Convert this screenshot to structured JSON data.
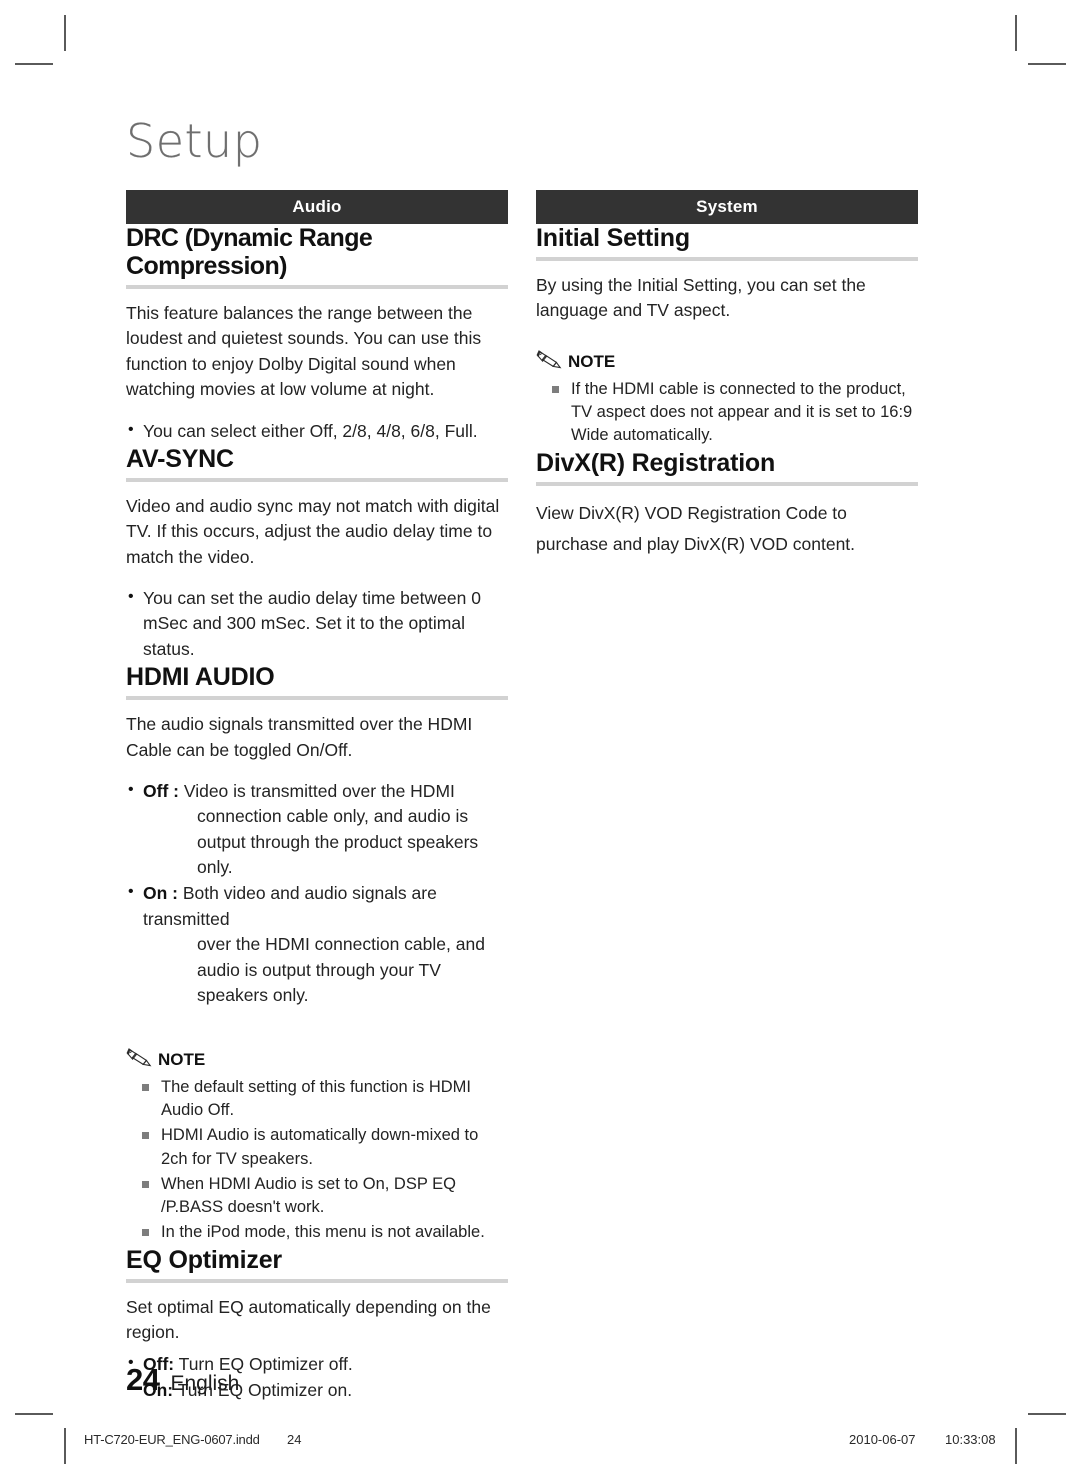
{
  "page": {
    "title": "Setup",
    "page_number": "24",
    "language": "English"
  },
  "left_column": {
    "banner": "Audio",
    "sections": [
      {
        "heading": "DRC (Dynamic Range Compression)",
        "paragraph": "This feature balances the range between the loudest and quietest sounds. You can use this function to enjoy Dolby Digital sound when watching movies at low volume at night.",
        "bullets": [
          {
            "text": "You can select either Off, 2/8, 4/8, 6/8, Full."
          }
        ]
      },
      {
        "heading": "AV-SYNC",
        "paragraph": "Video and audio sync may not match with digital TV. If this occurs, adjust the audio delay time to match the video.",
        "bullets": [
          {
            "text": "You can set the audio delay time between 0 mSec and 300 mSec. Set it to the optimal status."
          }
        ]
      },
      {
        "heading": "HDMI AUDIO",
        "paragraph": "The audio signals transmitted over the HDMI Cable can be toggled On/Off.",
        "bullets": [
          {
            "label": "Off :",
            "text": "Video is transmitted over the HDMI",
            "indent": "connection cable only, and audio is output through the product speakers only."
          },
          {
            "label": "On :",
            "text": "Both video and audio signals are transmitted",
            "indent": "over the HDMI connection cable, and audio is output through your TV speakers only."
          }
        ],
        "note": {
          "icon": "pencil-icon",
          "title": "NOTE",
          "items": [
            "The default setting of this function is HDMI Audio Off.",
            "HDMI Audio is automatically down-mixed to 2ch for TV speakers.",
            "When HDMI Audio is set to On, DSP EQ /P.BASS doesn't work.",
            "In the iPod mode, this menu is not available."
          ]
        }
      },
      {
        "heading": "EQ Optimizer",
        "paragraph": "Set optimal EQ automatically depending on the region.",
        "bullets": [
          {
            "label": "Off:",
            "text": "Turn EQ Optimizer off."
          },
          {
            "label": "On:",
            "text": "Turn EQ Optimizer on."
          }
        ]
      }
    ]
  },
  "right_column": {
    "banner": "System",
    "sections": [
      {
        "heading": "Initial Setting",
        "paragraph": "By using the Initial Setting, you can set the language and TV aspect.",
        "note": {
          "icon": "pencil-icon",
          "title": "NOTE",
          "items": [
            "If the HDMI cable is connected to the product, TV aspect does not appear and it is set to 16:9 Wide automatically."
          ]
        }
      },
      {
        "heading": "DivX(R) Registration",
        "paragraph": "View DivX(R) VOD Registration Code to purchase and play DivX(R) VOD content."
      }
    ]
  },
  "print_footer": {
    "filename": "HT-C720-EUR_ENG-0607.indd",
    "page": "24",
    "date": "2010-06-07",
    "time": "10:33:08"
  },
  "colors": {
    "banner_background": "#333333",
    "banner_text": "#ffffff",
    "heading_rule": "#d2d2d2",
    "title_text": "#6e6e6e",
    "body_text": "#232323",
    "crop_mark": "#5a5a5a"
  }
}
